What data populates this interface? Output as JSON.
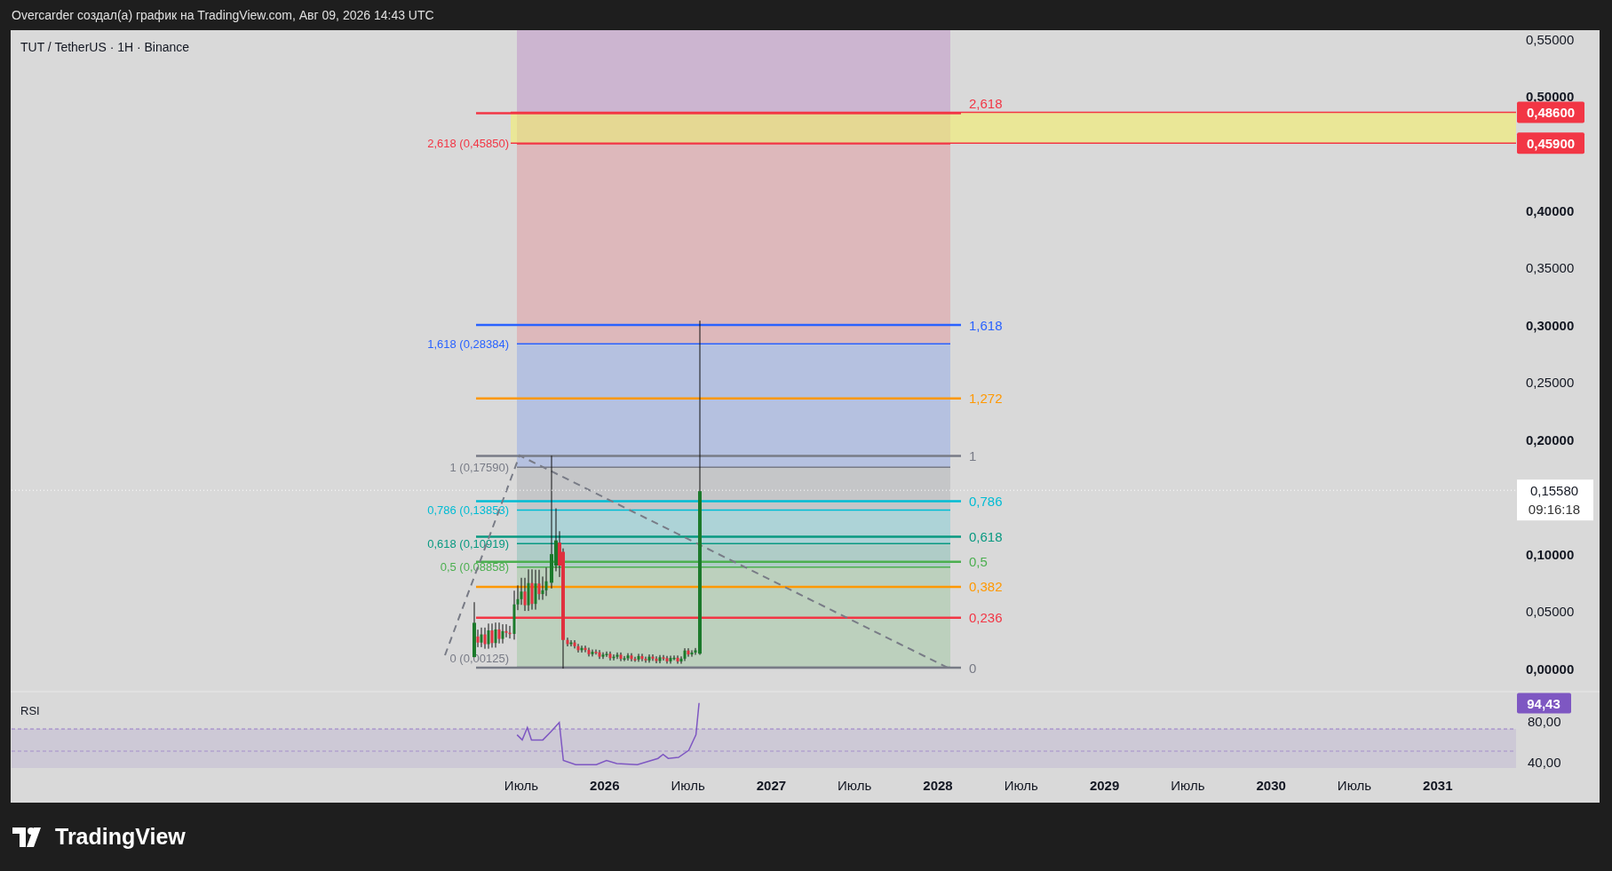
{
  "header": {
    "caption": "Overcarder создал(а) график на TradingView.com, Авг 09, 2026 14:43 UTC"
  },
  "chart": {
    "symbol": "TUT / TetherUS · 1H · Binance",
    "fib_right": [
      {
        "label": "2,618",
        "color": "#f23645"
      },
      {
        "label": "1,618",
        "color": "#2962ff"
      },
      {
        "label": "1,272",
        "color": "#ff9800"
      },
      {
        "label": "1",
        "color": "#787b86"
      },
      {
        "label": "0,786",
        "color": "#00bcd4"
      },
      {
        "label": "0,618",
        "color": "#089981"
      },
      {
        "label": "0,5",
        "color": "#4caf50"
      },
      {
        "label": "0,382",
        "color": "#ff9800"
      },
      {
        "label": "0,236",
        "color": "#f23645"
      },
      {
        "label": "0",
        "color": "#787b86"
      }
    ],
    "fib_left": [
      {
        "label": "2,618 (0,45850)",
        "color": "#f23645"
      },
      {
        "label": "1,618 (0,28384)",
        "color": "#2962ff"
      },
      {
        "label": "1 (0,17590)",
        "color": "#787b86"
      },
      {
        "label": "0,786 (0,13853)",
        "color": "#00bcd4"
      },
      {
        "label": "0,618 (0,10919)",
        "color": "#089981"
      },
      {
        "label": "0,5 (0,08858)",
        "color": "#4caf50"
      },
      {
        "label": "0 (0,00125)",
        "color": "#787b86"
      }
    ],
    "price_axis": [
      {
        "label": "0,55000",
        "major": false
      },
      {
        "label": "0,50000",
        "major": true
      },
      {
        "label": "0,40000",
        "major": true
      },
      {
        "label": "0,35000",
        "major": false
      },
      {
        "label": "0,30000",
        "major": true
      },
      {
        "label": "0,25000",
        "major": false
      },
      {
        "label": "0,20000",
        "major": true
      },
      {
        "label": "0,10000",
        "major": true
      },
      {
        "label": "0,05000",
        "major": false
      },
      {
        "label": "0,00000",
        "major": true
      }
    ],
    "price_tags": [
      "0,48600",
      "0,45900"
    ],
    "last_price": {
      "price": "0,15580",
      "countdown": "09:16:18"
    },
    "rsi": {
      "title": "RSI",
      "value": "94,43",
      "axis": [
        "80,00",
        "40,00"
      ]
    },
    "time_axis": [
      {
        "label": "Июль",
        "year": false
      },
      {
        "label": "2026",
        "year": true
      },
      {
        "label": "Июль",
        "year": false
      },
      {
        "label": "2027",
        "year": true
      },
      {
        "label": "Июль",
        "year": false
      },
      {
        "label": "2028",
        "year": true
      },
      {
        "label": "Июль",
        "year": false
      },
      {
        "label": "2029",
        "year": true
      },
      {
        "label": "Июль",
        "year": false
      },
      {
        "label": "2030",
        "year": true
      },
      {
        "label": "Июль",
        "year": false
      },
      {
        "label": "2031",
        "year": true
      }
    ]
  },
  "footer": {
    "brand": "TradingView"
  }
}
